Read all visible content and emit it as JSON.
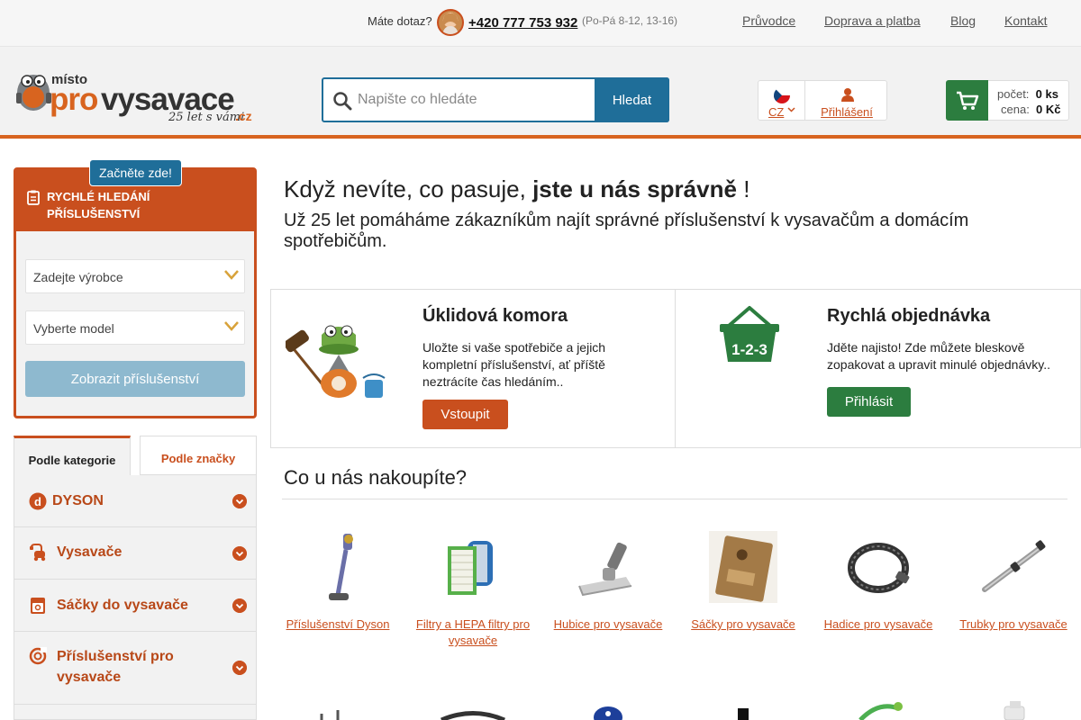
{
  "topbar": {
    "question": "Máte dotaz?",
    "phone": "+420 777 753 932",
    "hours": "(Po-Pá 8-12, 13-16)",
    "links": [
      "Průvodce",
      "Doprava a platba",
      "Blog",
      "Kontakt"
    ]
  },
  "header": {
    "logo_text_top": "místo",
    "logo_text_main_a": "pro",
    "logo_text_main_b": "vysavace",
    "logo_text_tag": "25 let s vámi",
    "logo_text_domain": ".cz",
    "search_placeholder": "Napište co hledáte",
    "search_button": "Hledat",
    "language": "CZ",
    "login": "Přihlášení",
    "cart_count_label": "počet:",
    "cart_count_value": "0 ks",
    "cart_price_label": "cena:",
    "cart_price_value": "0 Kč"
  },
  "quick_search": {
    "badge": "Začněte zde!",
    "title": "RYCHLÉ HLEDÁNÍ PŘÍSLUŠENSTVÍ",
    "manufacturer_placeholder": "Zadejte výrobce",
    "model_placeholder": "Vyberte model",
    "button": "Zobrazit příslušenství"
  },
  "category_tabs": {
    "active": "Podle kategorie",
    "inactive": "Podle značky"
  },
  "categories": [
    {
      "label": "DYSON",
      "icon": "dyson-logo-icon"
    },
    {
      "label": "Vysavače",
      "icon": "vacuum-icon"
    },
    {
      "label": "Sáčky do vysavače",
      "icon": "bag-icon"
    },
    {
      "label": "Příslušenství pro vysavače",
      "icon": "accessory-icon"
    }
  ],
  "hero": {
    "title_plain": "Když nevíte, co pasuje,",
    "title_bold": "jste u nás správně",
    "title_end": "!",
    "subtitle": "Už 25 let pomáháme zákazníkům najít správné příslušenství k vysavačům a domácím spotřebičům."
  },
  "cards": [
    {
      "title": "Úklidová komora",
      "text": "Uložte si vaše spotřebiče a jejich kompletní příslušenství, ať příště neztrácíte čas hledáním..",
      "button": "Vstoupit",
      "icon": "mascot-icon"
    },
    {
      "title": "Rychlá objednávka",
      "text": "Jděte najisto! Zde můžete bleskově zopakovat a upravit minulé objednávky..",
      "button": "Přihlásit",
      "icon": "basket-123-icon",
      "icon_text": "1-2-3"
    }
  ],
  "shop": {
    "title": "Co u nás nakoupíte?",
    "products": [
      {
        "label": "Příslušenství Dyson",
        "icon": "dyson-vacuum-icon"
      },
      {
        "label": "Filtry a HEPA filtry pro vysavače",
        "icon": "hepa-filter-icon"
      },
      {
        "label": "Hubice pro vysavače",
        "icon": "nozzle-icon"
      },
      {
        "label": "Sáčky pro vysavače",
        "icon": "vacuum-bag-icon"
      },
      {
        "label": "Hadice pro vysavače",
        "icon": "hose-icon"
      },
      {
        "label": "Trubky pro vysavače",
        "icon": "tube-icon"
      }
    ]
  },
  "colors": {
    "brand_orange": "#c94f1e",
    "blue": "#1f6e99",
    "green": "#2c7d3f"
  }
}
